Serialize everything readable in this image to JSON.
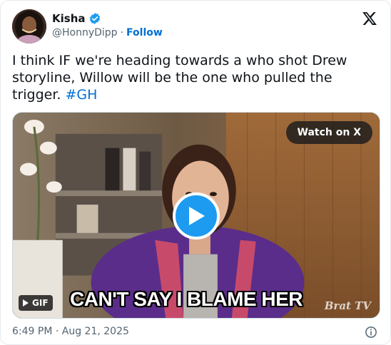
{
  "author": {
    "display_name": "Kisha",
    "handle": "@HonnyDipp",
    "separator": "·",
    "follow_label": "Follow"
  },
  "tweet": {
    "text": "I think IF we're heading towards a who shot Drew storyline, Willow will be the one who pulled the trigger.",
    "hashtag": "#GH"
  },
  "media": {
    "watch_label": "Watch on X",
    "gif_label": "GIF",
    "caption": "CAN'T SAY I BLAME HER",
    "watermark": "Brat TV"
  },
  "footer": {
    "timestamp": "6:49 PM · Aug 21, 2025"
  },
  "icons": {
    "verified": "verified-badge-icon",
    "x_logo": "x-logo-icon",
    "play": "play-icon",
    "info": "info-icon"
  },
  "colors": {
    "accent": "#1d9bf0",
    "link": "#006fd6",
    "muted": "#536471",
    "text": "#0f1419"
  }
}
